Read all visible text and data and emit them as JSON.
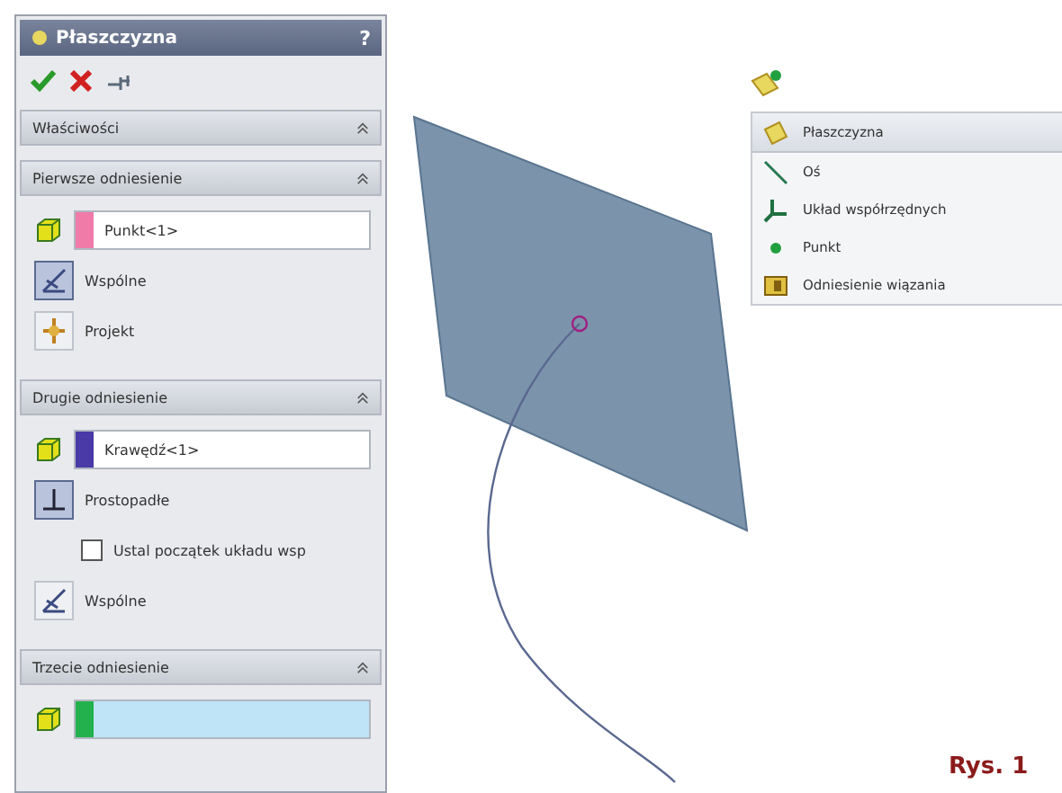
{
  "panel": {
    "title": "Płaszczyzna",
    "help": "?",
    "sections": [
      {
        "title": "Właściwości"
      },
      {
        "title": "Pierwsze odniesienie",
        "items": [
          {
            "kind": "field",
            "value": "Punkt<1>",
            "color": "#f07aa8",
            "selected": false
          },
          {
            "kind": "coincident",
            "label": "Wspólne",
            "selected": true
          },
          {
            "kind": "project",
            "label": "Projekt",
            "selected": false
          }
        ]
      },
      {
        "title": "Drugie odniesienie",
        "items": [
          {
            "kind": "field",
            "value": "Krawędź<1>",
            "color": "#4a3aa8",
            "selected": false
          },
          {
            "kind": "perpendicular",
            "label": "Prostopadłe",
            "selected": true
          },
          {
            "kind": "checkbox",
            "label": "Ustal początek układu wsp",
            "checked": false
          },
          {
            "kind": "coincident",
            "label": "Wspólne",
            "selected": false
          }
        ]
      },
      {
        "title": "Trzecie odniesienie",
        "items": [
          {
            "kind": "field",
            "color": "#22b14c",
            "selected": true
          }
        ]
      }
    ]
  },
  "menu": {
    "items": [
      {
        "label": "Płaszczyzna",
        "selected": true
      },
      {
        "label": "Oś",
        "selected": false
      },
      {
        "label": "Układ współrzędnych",
        "selected": false
      },
      {
        "label": "Punkt",
        "selected": false
      },
      {
        "label": "Odniesienie wiązania",
        "selected": false
      }
    ]
  },
  "caption": "Rys. 1"
}
